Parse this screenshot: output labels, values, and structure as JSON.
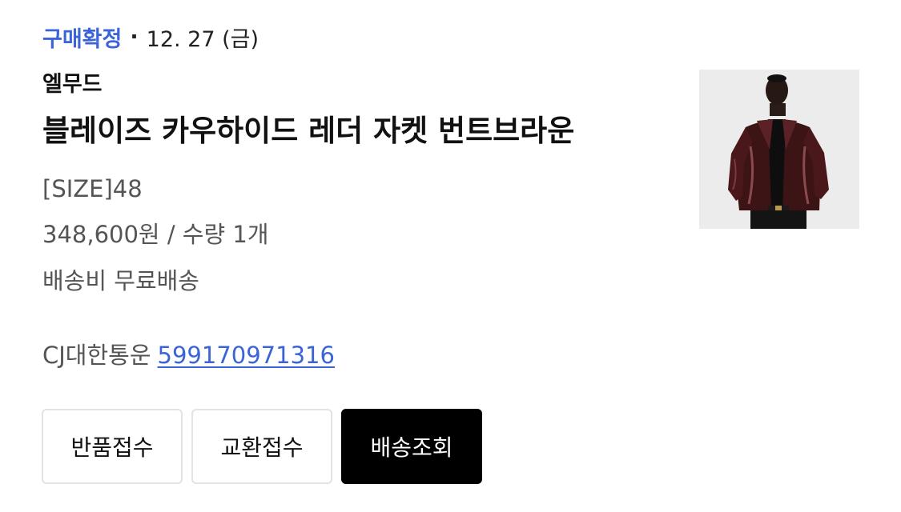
{
  "order": {
    "status": "구매확정",
    "separator": "·",
    "date": "12. 27 (금)"
  },
  "product": {
    "brand": "엘무드",
    "name": "블레이즈 카우하이드 레더 자켓 번트브라운",
    "size": "[SIZE]48",
    "price_quantity": "348,600원 / 수량 1개",
    "shipping_fee": "배송비 무료배송",
    "image_alt": "burnt brown leather jacket product photo"
  },
  "delivery": {
    "carrier": "CJ대한통운",
    "tracking_number": "599170971316"
  },
  "actions": {
    "return_label": "반품접수",
    "exchange_label": "교환접수",
    "track_label": "배송조회"
  },
  "colors": {
    "accent": "#3b64d9",
    "primary_button": "#000000"
  }
}
